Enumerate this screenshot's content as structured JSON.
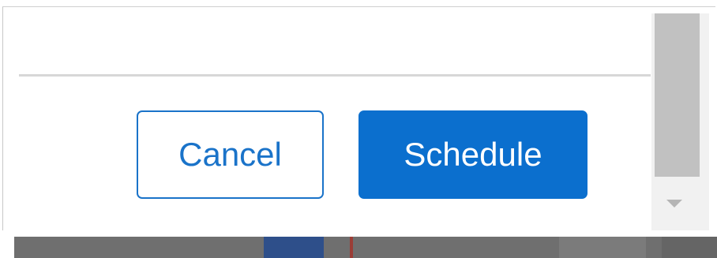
{
  "dialog": {
    "buttons": {
      "cancel_label": "Cancel",
      "schedule_label": "Schedule"
    }
  },
  "colors": {
    "primary": "#0b6fce",
    "primary_outline": "#1a73c9",
    "scrollbar_track": "#f1f1f1",
    "scrollbar_thumb": "#c1c1c1"
  },
  "icons": {
    "scroll_down": "triangle-down-icon"
  }
}
